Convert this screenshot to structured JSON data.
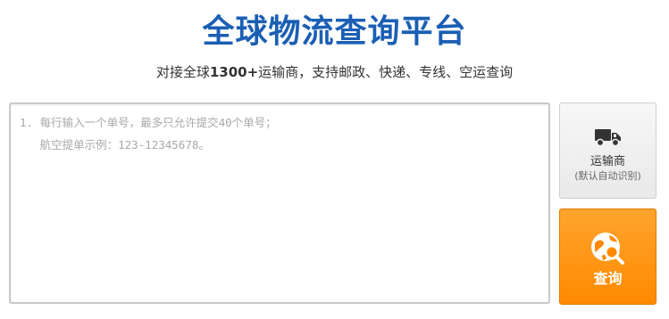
{
  "header": {
    "title": "全球物流查询平台",
    "subtitle_pre": "对接全球",
    "subtitle_count": "1300+",
    "subtitle_post": "运输商，支持邮政、快递、专线、空运查询"
  },
  "input": {
    "value": "",
    "placeholder": "1. 每行输入一个单号，最多只允许提交40个单号；\n   航空提单示例：123-12345678。"
  },
  "carrier_button": {
    "label": "运输商",
    "sub_label": "(默认自动识别)",
    "icon": "truck-icon"
  },
  "query_button": {
    "label": "查询",
    "icon": "globe-search-icon",
    "color": "#ff9200"
  },
  "colors": {
    "title": "#1b5fb4",
    "query_button": "#ff9200"
  }
}
